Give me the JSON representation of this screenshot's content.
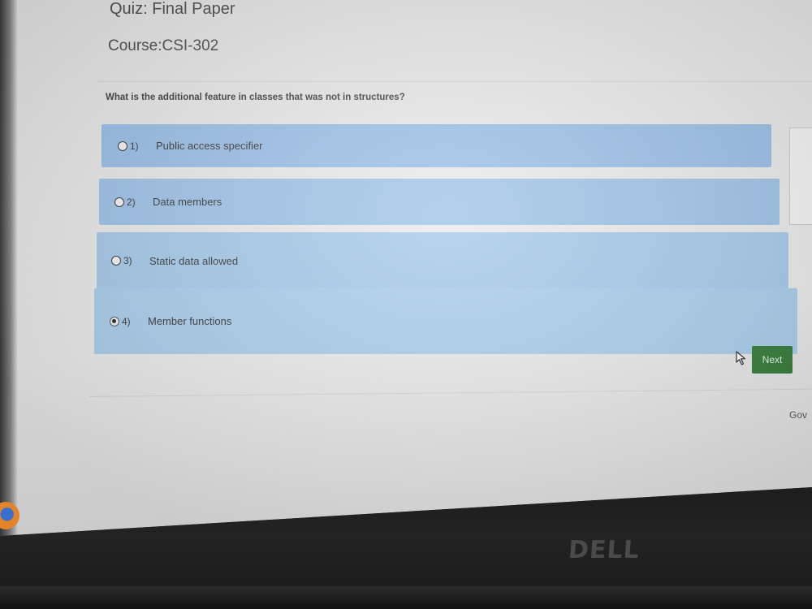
{
  "quiz": {
    "title": "Quiz: Final Paper",
    "course": "Course:CSI-302"
  },
  "question": {
    "text": "What is the additional feature in classes that was not in structures?"
  },
  "options": [
    {
      "number": "1)",
      "label": "Public access specifier",
      "selected": false
    },
    {
      "number": "2)",
      "label": "Data members",
      "selected": false
    },
    {
      "number": "3)",
      "label": "Static data allowed",
      "selected": false
    },
    {
      "number": "4)",
      "label": "Member functions",
      "selected": true
    }
  ],
  "actions": {
    "next_label": "Next"
  },
  "footer": {
    "text": "Gov"
  },
  "hardware": {
    "brand": "DELL"
  },
  "colors": {
    "option_bg": "#9cc1e8",
    "next_button": "#317a35",
    "page_bg": "#e9e9ea"
  },
  "icons": {
    "cursor": "mouse-pointer-icon",
    "taskbar": "browser-icon"
  }
}
